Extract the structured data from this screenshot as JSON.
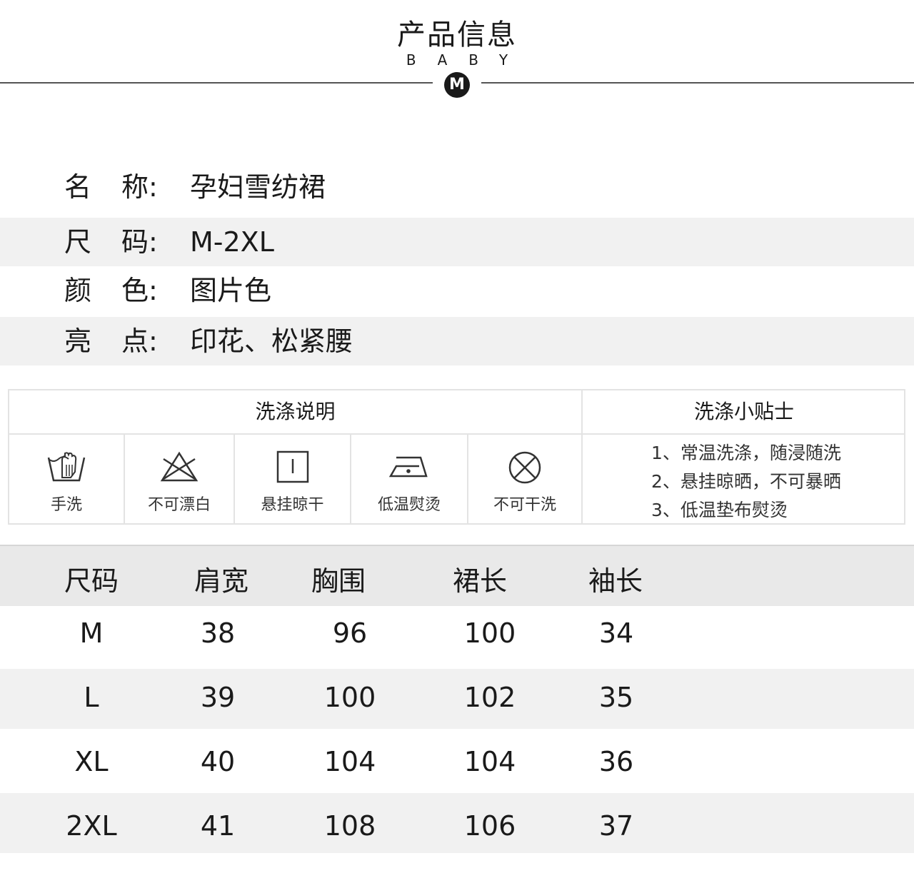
{
  "header": {
    "title": "产品信息",
    "subtitle": "BABY",
    "badge": "M"
  },
  "info": [
    {
      "label_a": "名",
      "label_b": "称:",
      "value": "孕妇雪纺裙"
    },
    {
      "label_a": "尺",
      "label_b": "码:",
      "value": "M-2XL"
    },
    {
      "label_a": "颜",
      "label_b": "色:",
      "value": "图片色"
    },
    {
      "label_a": "亮",
      "label_b": "点:",
      "value": "印花、松紧腰"
    }
  ],
  "washing": {
    "instructions_title": "洗涤说明",
    "tips_title": "洗涤小贴士",
    "icons": [
      {
        "icon": "hand-wash-icon",
        "caption": "手洗"
      },
      {
        "icon": "no-bleach-icon",
        "caption": "不可漂白"
      },
      {
        "icon": "hang-dry-icon",
        "caption": "悬挂晾干"
      },
      {
        "icon": "low-iron-icon",
        "caption": "低温熨烫"
      },
      {
        "icon": "no-dry-clean-icon",
        "caption": "不可干洗"
      }
    ],
    "tips": [
      "1、常温洗涤，随浸随洗",
      "2、悬挂晾晒，不可暴晒",
      "3、低温垫布熨烫"
    ]
  },
  "size_table": {
    "headers": [
      "尺码",
      "肩宽",
      "胸围",
      "裙长",
      "袖长"
    ],
    "rows": [
      [
        "M",
        "38",
        "96",
        "100",
        "34"
      ],
      [
        "L",
        "39",
        "100",
        "102",
        "35"
      ],
      [
        "XL",
        "40",
        "104",
        "104",
        "36"
      ],
      [
        "2XL",
        "41",
        "108",
        "106",
        "37"
      ]
    ]
  }
}
